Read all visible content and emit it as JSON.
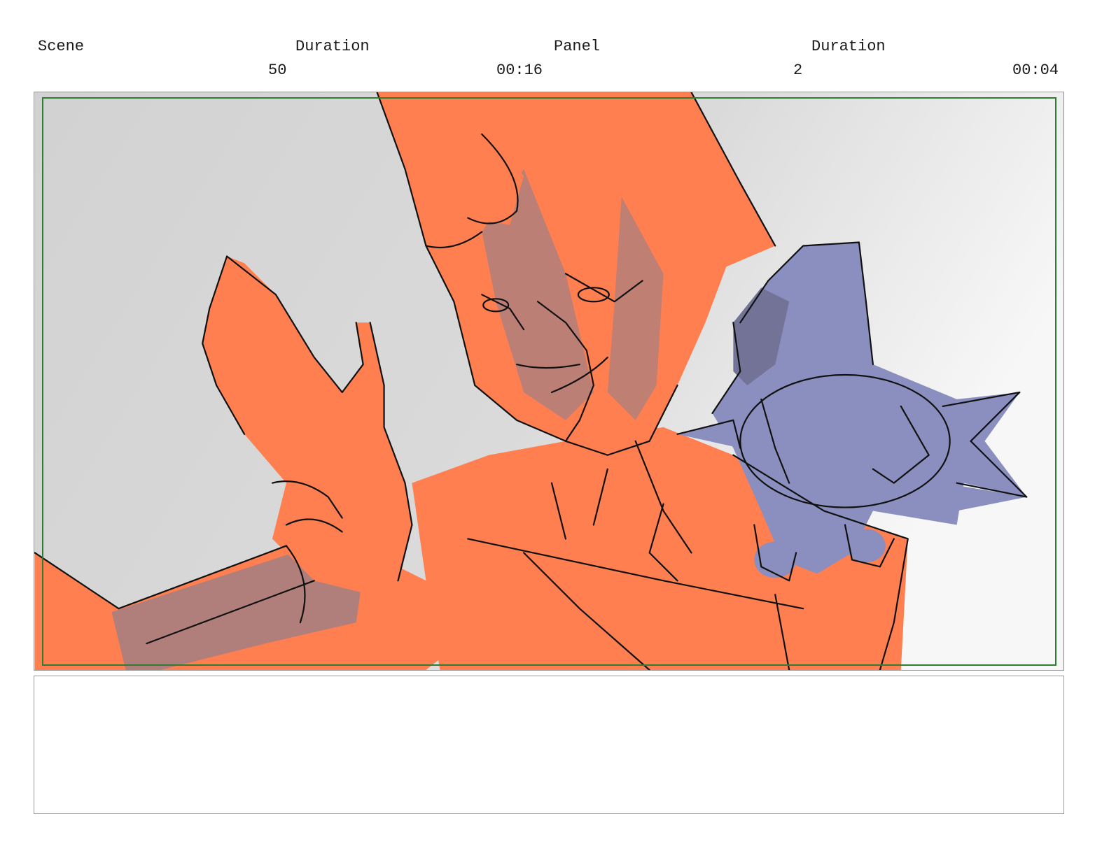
{
  "header": {
    "scene_label": "Scene",
    "scene_duration_label": "Duration",
    "panel_label": "Panel",
    "panel_duration_label": "Duration",
    "scene_number": "50",
    "scene_duration": "00:16",
    "panel_number": "2",
    "panel_duration": "00:04"
  },
  "panel": {
    "colors": {
      "background": "#d6d6d6",
      "character_fill": "#ff7f50",
      "character_shadow": "#b07f7c",
      "creature_fill": "#8a8fbf",
      "creature_shadow": "#727396",
      "line": "#111111",
      "safe_area": "#2e7d32"
    }
  },
  "notes": {
    "text": ""
  }
}
